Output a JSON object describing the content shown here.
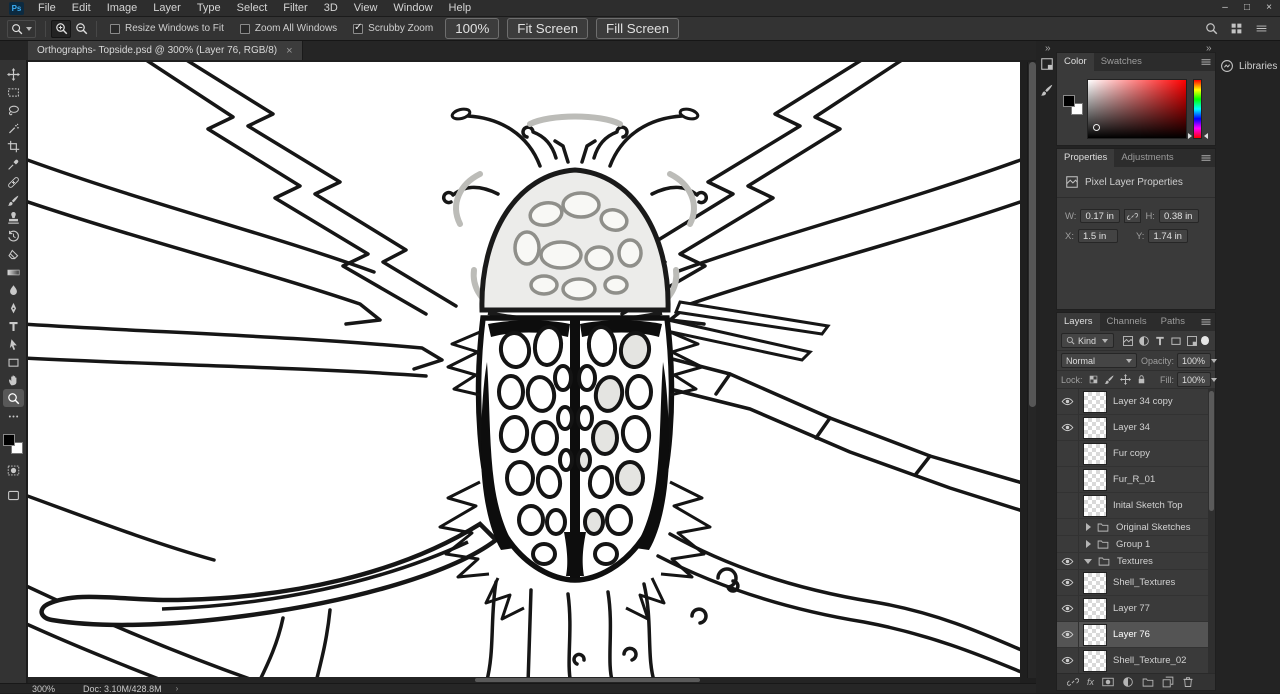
{
  "app": {
    "logo": "Ps"
  },
  "menu_bar": {
    "items": [
      "File",
      "Edit",
      "Image",
      "Layer",
      "Type",
      "Select",
      "Filter",
      "3D",
      "View",
      "Window",
      "Help"
    ]
  },
  "window_controls": {
    "minimize": "–",
    "restore": "□",
    "close": "×"
  },
  "options_bar": {
    "checkboxes": [
      {
        "label": "Resize Windows to Fit",
        "checked": false
      },
      {
        "label": "Zoom All Windows",
        "checked": false
      },
      {
        "label": "Scrubby Zoom",
        "checked": true
      }
    ],
    "zoom_level_button": "100%",
    "fit_screen_button": "Fit Screen",
    "fill_screen_button": "Fill Screen"
  },
  "document_tab": {
    "title": "Orthographs- Topside.psd @ 300% (Layer 76, RGB/8)",
    "close_glyph": "×"
  },
  "toolbar": {
    "active_tool": "zoom",
    "tools": [
      {
        "id": "move",
        "sym": "move"
      },
      {
        "id": "rectangular-marquee",
        "sym": "marquee"
      },
      {
        "id": "lasso",
        "sym": "lasso"
      },
      {
        "id": "magic-wand",
        "sym": "wand"
      },
      {
        "id": "crop",
        "sym": "crop"
      },
      {
        "id": "eyedropper",
        "sym": "eyedropper"
      },
      {
        "id": "spot-healing-brush",
        "sym": "heal"
      },
      {
        "id": "brush",
        "sym": "brush"
      },
      {
        "id": "clone-stamp",
        "sym": "stamp"
      },
      {
        "id": "history-brush",
        "sym": "history"
      },
      {
        "id": "eraser",
        "sym": "eraser"
      },
      {
        "id": "gradient",
        "sym": "gradient"
      },
      {
        "id": "blur",
        "sym": "blur"
      },
      {
        "id": "pen",
        "sym": "pen"
      },
      {
        "id": "type",
        "sym": "type"
      },
      {
        "id": "path-selection",
        "sym": "pathsel"
      },
      {
        "id": "rectangle",
        "sym": "shape"
      },
      {
        "id": "hand",
        "sym": "hand"
      },
      {
        "id": "zoom",
        "sym": "zoom"
      },
      {
        "id": "more-tools",
        "sym": "ellipsis"
      }
    ],
    "foreground_color": "#000000",
    "background_color": "#ffffff"
  },
  "color_panel": {
    "tabs": [
      "Color",
      "Swatches"
    ],
    "active_tab": "Color",
    "selected_hue": "#ff0000"
  },
  "properties_panel": {
    "tabs": [
      "Properties",
      "Adjustments"
    ],
    "active_tab": "Properties",
    "title": "Pixel Layer Properties",
    "w_label": "W:",
    "w_value": "0.17 in",
    "h_label": "H:",
    "h_value": "0.38 in",
    "x_label": "X:",
    "x_value": "1.5 in",
    "y_label": "Y:",
    "y_value": "1.74 in"
  },
  "layers_panel": {
    "tabs": [
      "Layers",
      "Channels",
      "Paths"
    ],
    "active_tab": "Layers",
    "filter_label": "Kind",
    "filter_icons": [
      {
        "id": "filter-pixel-layers",
        "sym": "pixel"
      },
      {
        "id": "filter-adjustment-layers",
        "sym": "adjust"
      },
      {
        "id": "filter-type-layers",
        "sym": "type"
      },
      {
        "id": "filter-shape-layers",
        "sym": "shape"
      },
      {
        "id": "filter-smart-objects",
        "sym": "smart"
      }
    ],
    "blend_mode": "Normal",
    "opacity_label": "Opacity:",
    "opacity_value": "100%",
    "lock_label": "Lock:",
    "lock_icons": [
      {
        "id": "lock-transparent-pixels",
        "sym": "checker"
      },
      {
        "id": "lock-image-pixels",
        "sym": "brush"
      },
      {
        "id": "lock-position",
        "sym": "move"
      },
      {
        "id": "lock-all",
        "sym": "lock"
      }
    ],
    "fill_label": "Fill:",
    "fill_value": "100%",
    "layers": [
      {
        "name": "Layer 34 copy",
        "type": "layer",
        "visible": true
      },
      {
        "name": "Layer 34",
        "type": "layer",
        "visible": true
      },
      {
        "name": "Fur copy",
        "type": "layer",
        "visible": false
      },
      {
        "name": "Fur_R_01",
        "type": "layer",
        "visible": false
      },
      {
        "name": "Inital Sketch Top",
        "type": "layer",
        "visible": false
      },
      {
        "name": "Original Sketches",
        "type": "group",
        "visible": false,
        "expanded": false
      },
      {
        "name": "Group 1",
        "type": "group",
        "visible": false,
        "expanded": false
      },
      {
        "name": "Textures",
        "type": "group",
        "visible": true,
        "expanded": true
      },
      {
        "name": "Shell_Textures",
        "type": "layer",
        "visible": true
      },
      {
        "name": "Layer 77",
        "type": "layer",
        "visible": true
      },
      {
        "name": "Layer 76",
        "type": "layer",
        "visible": true,
        "selected": true
      },
      {
        "name": "Shell_Texture_02",
        "type": "layer",
        "visible": true
      }
    ],
    "footer_icons": [
      {
        "id": "link-layers",
        "sym": "link"
      },
      {
        "id": "layer-style",
        "sym": "fx"
      },
      {
        "id": "add-layer-mask",
        "sym": "mask"
      },
      {
        "id": "new-adjustment-layer",
        "sym": "adjust"
      },
      {
        "id": "new-group",
        "sym": "folder"
      },
      {
        "id": "new-layer",
        "sym": "newlayer"
      },
      {
        "id": "delete-layer",
        "sym": "trash"
      }
    ]
  },
  "libraries_panel": {
    "label": "Libraries"
  },
  "status_bar": {
    "zoom": "300%",
    "doc_info": "Doc: 3.10M/428.8M",
    "arrow": "›"
  }
}
